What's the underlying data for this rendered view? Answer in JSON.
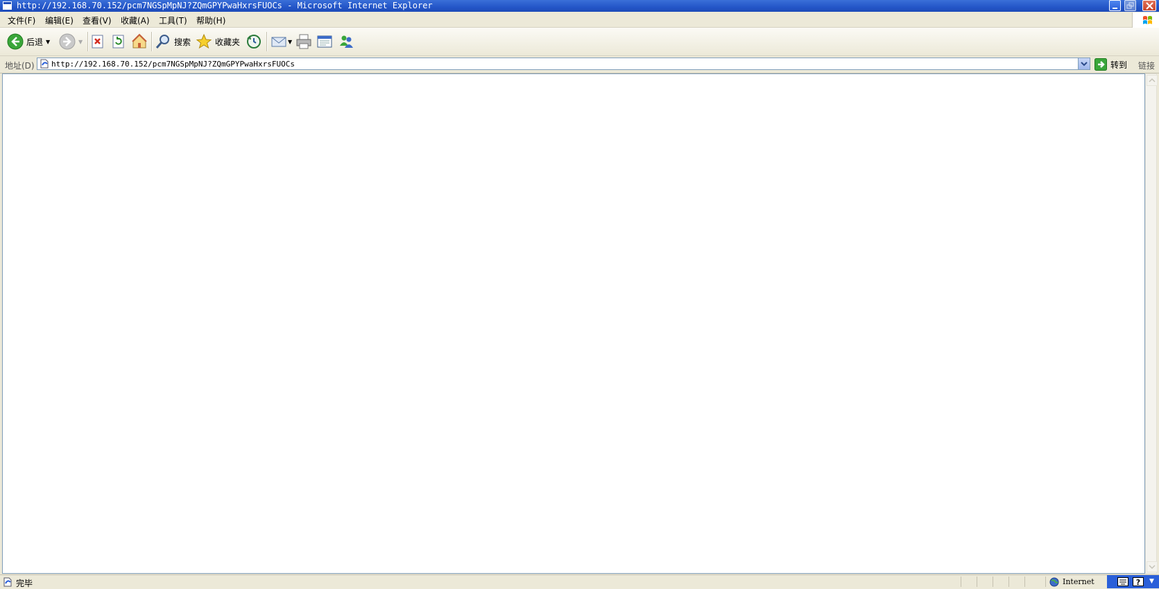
{
  "window": {
    "title": "http://192.168.70.152/pcm7NGSpMpNJ?ZQmGPYPwaHxrsFUOCs - Microsoft Internet Explorer"
  },
  "menubar": {
    "items": [
      {
        "label": "文件(F)"
      },
      {
        "label": "编辑(E)"
      },
      {
        "label": "查看(V)"
      },
      {
        "label": "收藏(A)"
      },
      {
        "label": "工具(T)"
      },
      {
        "label": "帮助(H)"
      }
    ]
  },
  "toolbar": {
    "back_label": "后退",
    "search_label": "搜索",
    "favorites_label": "收藏夹"
  },
  "address": {
    "label": "地址(D)",
    "url": "http://192.168.70.152/pcm7NGSpMpNJ?ZQmGPYPwaHxrsFUOCs",
    "go_label": "转到",
    "links_label": "链接"
  },
  "status": {
    "text": "完毕",
    "zone": "Internet"
  },
  "colors": {
    "titlebar": "#2456c8",
    "chrome": "#ece9d8",
    "address_border": "#7f9db9"
  },
  "icons": [
    "ie-page-icon",
    "back-arrow-icon",
    "forward-arrow-icon",
    "stop-icon",
    "refresh-icon",
    "home-icon",
    "search-magnifier-icon",
    "favorites-star-icon",
    "history-icon",
    "mail-icon",
    "print-icon",
    "edit-icon",
    "messenger-icon",
    "go-arrow-icon",
    "globe-icon",
    "keyboard-icon",
    "help-icon"
  ]
}
